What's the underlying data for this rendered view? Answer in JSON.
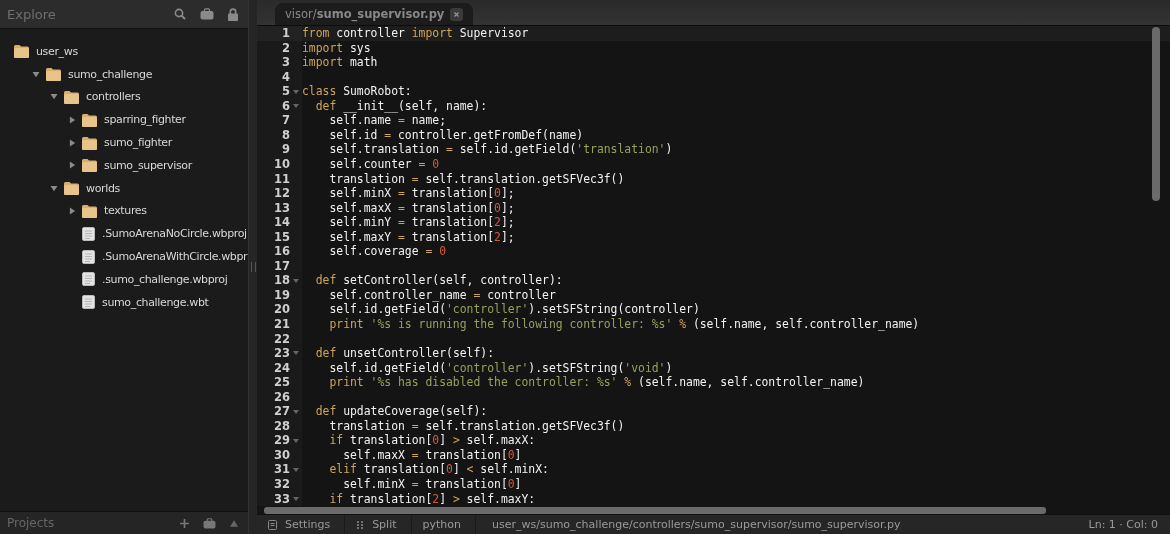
{
  "sidebar": {
    "title": "Explore",
    "tree": {
      "label": "user_ws",
      "kind": "folder",
      "children": [
        {
          "label": "sumo_challenge",
          "kind": "folder",
          "expanded": true,
          "children": [
            {
              "label": "controllers",
              "kind": "folder",
              "expanded": true,
              "children": [
                {
                  "label": "sparring_fighter",
                  "kind": "folder",
                  "expanded": false
                },
                {
                  "label": "sumo_fighter",
                  "kind": "folder",
                  "expanded": false
                },
                {
                  "label": "sumo_supervisor",
                  "kind": "folder",
                  "expanded": false
                }
              ]
            },
            {
              "label": "worlds",
              "kind": "folder",
              "expanded": true,
              "children": [
                {
                  "label": "textures",
                  "kind": "folder",
                  "expanded": false
                },
                {
                  "label": ".SumoArenaNoCircle.wbproj",
                  "kind": "file"
                },
                {
                  "label": ".SumoArenaWithCircle.wbpr",
                  "kind": "file"
                },
                {
                  "label": ".sumo_challenge.wbproj",
                  "kind": "file"
                },
                {
                  "label": "sumo_challenge.wbt",
                  "kind": "file"
                }
              ]
            }
          ]
        }
      ]
    },
    "footer_title": "Projects"
  },
  "tabs": [
    {
      "label": "visor/**sumo_supervisor.py**",
      "selected": true
    }
  ],
  "code": [
    {
      "number": "1",
      "fold": false,
      "active": true,
      "tokens": [
        {
          "kind": "kw",
          "text": "from"
        },
        {
          "kind": "plain",
          "text": " controller "
        },
        {
          "kind": "kw",
          "text": "import"
        },
        {
          "kind": "plain",
          "text": " Supervisor"
        }
      ]
    },
    {
      "number": "2",
      "fold": false,
      "active": false,
      "tokens": [
        {
          "kind": "kw",
          "text": "import"
        },
        {
          "kind": "plain",
          "text": " sys"
        }
      ]
    },
    {
      "number": "3",
      "fold": false,
      "active": false,
      "tokens": [
        {
          "kind": "kw",
          "text": "import"
        },
        {
          "kind": "plain",
          "text": " math"
        }
      ]
    },
    {
      "number": "4",
      "fold": false,
      "active": false
    },
    {
      "number": "5",
      "fold": true,
      "active": false,
      "tokens": [
        {
          "kind": "kw",
          "text": "class"
        },
        {
          "kind": "plain",
          "text": " SumoRobot:"
        }
      ]
    },
    {
      "number": "6",
      "fold": true,
      "active": false,
      "tokens": [
        {
          "kind": "kw",
          "text": "  def"
        },
        {
          "kind": "plain",
          "text": " __init__(self, name):"
        }
      ]
    },
    {
      "number": "7",
      "fold": false,
      "active": false,
      "tokens": [
        {
          "kind": "plain",
          "text": "    self.name "
        },
        {
          "kind": "op",
          "text": "="
        },
        {
          "kind": "plain",
          "text": " name;"
        }
      ]
    },
    {
      "number": "8",
      "fold": false,
      "active": false,
      "tokens": [
        {
          "kind": "plain",
          "text": "    self.id "
        },
        {
          "kind": "op",
          "text": "="
        },
        {
          "kind": "plain",
          "text": " controller.getFromDef(name)"
        }
      ]
    },
    {
      "number": "9",
      "fold": false,
      "active": false,
      "tokens": [
        {
          "kind": "plain",
          "text": "    self.translation "
        },
        {
          "kind": "op",
          "text": "="
        },
        {
          "kind": "plain",
          "text": " self.id.getField("
        },
        {
          "kind": "str",
          "text": "'translation'"
        },
        {
          "kind": "plain",
          "text": ")"
        }
      ]
    },
    {
      "number": "10",
      "fold": false,
      "active": false,
      "tokens": [
        {
          "kind": "plain",
          "text": "    self.counter "
        },
        {
          "kind": "op",
          "text": "= "
        },
        {
          "kind": "num",
          "text": "0"
        }
      ]
    },
    {
      "number": "11",
      "fold": false,
      "active": false,
      "tokens": [
        {
          "kind": "plain",
          "text": "    translation "
        },
        {
          "kind": "op",
          "text": "="
        },
        {
          "kind": "plain",
          "text": " self.translation.getSFVec3f()"
        }
      ]
    },
    {
      "number": "12",
      "fold": false,
      "active": false,
      "tokens": [
        {
          "kind": "plain",
          "text": "    self.minX "
        },
        {
          "kind": "op",
          "text": "="
        },
        {
          "kind": "plain",
          "text": " translation["
        },
        {
          "kind": "num",
          "text": "0"
        },
        {
          "kind": "plain",
          "text": "];"
        }
      ]
    },
    {
      "number": "13",
      "fold": false,
      "active": false,
      "tokens": [
        {
          "kind": "plain",
          "text": "    self.maxX "
        },
        {
          "kind": "op",
          "text": "="
        },
        {
          "kind": "plain",
          "text": " translation["
        },
        {
          "kind": "num",
          "text": "0"
        },
        {
          "kind": "plain",
          "text": "];"
        }
      ]
    },
    {
      "number": "14",
      "fold": false,
      "active": false,
      "tokens": [
        {
          "kind": "plain",
          "text": "    self.minY "
        },
        {
          "kind": "op",
          "text": "="
        },
        {
          "kind": "plain",
          "text": " translation["
        },
        {
          "kind": "num",
          "text": "2"
        },
        {
          "kind": "plain",
          "text": "];"
        }
      ]
    },
    {
      "number": "15",
      "fold": false,
      "active": false,
      "tokens": [
        {
          "kind": "plain",
          "text": "    self.maxY "
        },
        {
          "kind": "op",
          "text": "="
        },
        {
          "kind": "plain",
          "text": " translation["
        },
        {
          "kind": "num",
          "text": "2"
        },
        {
          "kind": "plain",
          "text": "];"
        }
      ]
    },
    {
      "number": "16",
      "fold": false,
      "active": false,
      "tokens": [
        {
          "kind": "plain",
          "text": "    self.coverage "
        },
        {
          "kind": "op",
          "text": "= "
        },
        {
          "kind": "num",
          "text": "0"
        }
      ]
    },
    {
      "number": "17",
      "fold": false,
      "active": false
    },
    {
      "number": "18",
      "fold": true,
      "active": false,
      "tokens": [
        {
          "kind": "kw",
          "text": "  def"
        },
        {
          "kind": "plain",
          "text": " setController(self, controller):"
        }
      ]
    },
    {
      "number": "19",
      "fold": false,
      "active": false,
      "tokens": [
        {
          "kind": "plain",
          "text": "    self.controller_name "
        },
        {
          "kind": "op",
          "text": "="
        },
        {
          "kind": "plain",
          "text": " controller"
        }
      ]
    },
    {
      "number": "20",
      "fold": false,
      "active": false,
      "tokens": [
        {
          "kind": "plain",
          "text": "    self.id.getField("
        },
        {
          "kind": "str",
          "text": "'controller'"
        },
        {
          "kind": "plain",
          "text": ").setSFString(controller)"
        }
      ]
    },
    {
      "number": "21",
      "fold": false,
      "active": false,
      "tokens": [
        {
          "kind": "kw",
          "text": "    print "
        },
        {
          "kind": "str",
          "text": "'%s is running the following controller: %s' "
        },
        {
          "kind": "op",
          "text": "%"
        },
        {
          "kind": "plain",
          "text": " (self.name, self.controller_name)"
        }
      ]
    },
    {
      "number": "22",
      "fold": false,
      "active": false
    },
    {
      "number": "23",
      "fold": true,
      "active": false,
      "tokens": [
        {
          "kind": "kw",
          "text": "  def"
        },
        {
          "kind": "plain",
          "text": " unsetController(self):"
        }
      ]
    },
    {
      "number": "24",
      "fold": false,
      "active": false,
      "tokens": [
        {
          "kind": "plain",
          "text": "    self.id.getField("
        },
        {
          "kind": "str",
          "text": "'controller'"
        },
        {
          "kind": "plain",
          "text": ").setSFString("
        },
        {
          "kind": "str",
          "text": "'void'"
        },
        {
          "kind": "plain",
          "text": ")"
        }
      ]
    },
    {
      "number": "25",
      "fold": false,
      "active": false,
      "tokens": [
        {
          "kind": "kw",
          "text": "    print "
        },
        {
          "kind": "str",
          "text": "'%s has disabled the controller: %s' "
        },
        {
          "kind": "op",
          "text": "%"
        },
        {
          "kind": "plain",
          "text": " (self.name, self.controller_name)"
        }
      ]
    },
    {
      "number": "26",
      "fold": false,
      "active": false
    },
    {
      "number": "27",
      "fold": true,
      "active": false,
      "tokens": [
        {
          "kind": "kw",
          "text": "  def"
        },
        {
          "kind": "plain",
          "text": " updateCoverage(self):"
        }
      ]
    },
    {
      "number": "28",
      "fold": false,
      "active": false,
      "tokens": [
        {
          "kind": "plain",
          "text": "    translation "
        },
        {
          "kind": "op",
          "text": "="
        },
        {
          "kind": "plain",
          "text": " self.translation.getSFVec3f()"
        }
      ]
    },
    {
      "number": "29",
      "fold": true,
      "active": false,
      "tokens": [
        {
          "kind": "kw",
          "text": "    if"
        },
        {
          "kind": "plain",
          "text": " translation["
        },
        {
          "kind": "num",
          "text": "0"
        },
        {
          "kind": "plain",
          "text": "] "
        },
        {
          "kind": "op",
          "text": ">"
        },
        {
          "kind": "plain",
          "text": " self.maxX:"
        }
      ]
    },
    {
      "number": "30",
      "fold": false,
      "active": false,
      "tokens": [
        {
          "kind": "plain",
          "text": "      self.maxX "
        },
        {
          "kind": "op",
          "text": "="
        },
        {
          "kind": "plain",
          "text": " translation["
        },
        {
          "kind": "num",
          "text": "0"
        },
        {
          "kind": "plain",
          "text": "]"
        }
      ]
    },
    {
      "number": "31",
      "fold": true,
      "active": false,
      "tokens": [
        {
          "kind": "kw",
          "text": "    elif"
        },
        {
          "kind": "plain",
          "text": " translation["
        },
        {
          "kind": "num",
          "text": "0"
        },
        {
          "kind": "plain",
          "text": "] "
        },
        {
          "kind": "op",
          "text": "<"
        },
        {
          "kind": "plain",
          "text": " self.minX:"
        }
      ]
    },
    {
      "number": "32",
      "fold": false,
      "active": false,
      "tokens": [
        {
          "kind": "plain",
          "text": "      self.minX "
        },
        {
          "kind": "op",
          "text": "="
        },
        {
          "kind": "plain",
          "text": " translation["
        },
        {
          "kind": "num",
          "text": "0"
        },
        {
          "kind": "plain",
          "text": "]"
        }
      ]
    },
    {
      "number": "33",
      "fold": true,
      "active": false,
      "tokens": [
        {
          "kind": "kw",
          "text": "    if"
        },
        {
          "kind": "plain",
          "text": " translation["
        },
        {
          "kind": "num",
          "text": "2"
        },
        {
          "kind": "plain",
          "text": "] "
        },
        {
          "kind": "op",
          "text": ">"
        },
        {
          "kind": "plain",
          "text": " self.maxY:"
        }
      ]
    }
  ],
  "status_bar": {
    "settings": "Settings",
    "split": "Split",
    "language": "python",
    "path": "user_ws/sumo_challenge/controllers/sumo_supervisor/sumo_supervisor.py",
    "position": "Ln: 1 · Col: 0"
  }
}
